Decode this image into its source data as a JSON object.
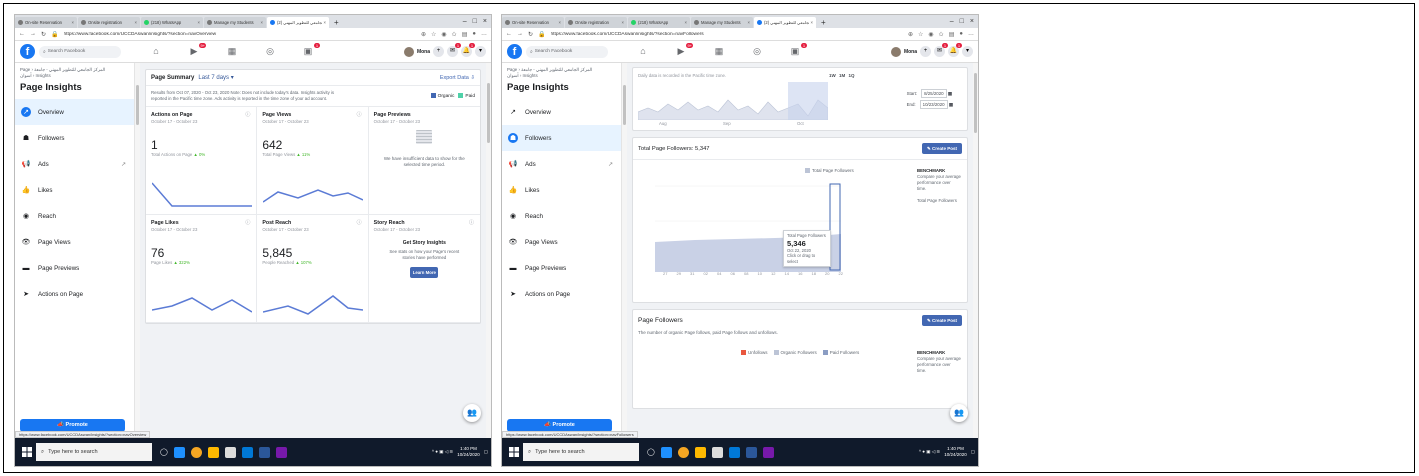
{
  "browser": {
    "tabs": [
      {
        "label": "On-site Reservation"
      },
      {
        "label": "Onsite registration"
      },
      {
        "label": "(218) WhatsApp"
      },
      {
        "label": "Manage my Students"
      },
      {
        "label": "المركز الجامعي للتطوير المهني (2)"
      }
    ]
  },
  "left": {
    "url": "https://www.facebook.com/UCCDAswan/insights/?section=navOverview",
    "status_url": "https://www.facebook.com/UCCDAswan/insights/?section=navOverview"
  },
  "right": {
    "url": "https://www.facebook.com/UCCDAswan/insights/?section=navFollowers",
    "status_url": "https://www.facebook.com/UCCDAswan/insights/?section=navFollowers"
  },
  "facebook": {
    "search_placeholder": "Search Facebook",
    "badges": {
      "watch": "9+",
      "notifications": "1",
      "messenger": "1",
      "alerts": "1"
    },
    "user_name": "Mona"
  },
  "sidebar": {
    "breadcrumb": "Page › المركز الجامعي للتطوير المهني - جامعة أسوان › Insights",
    "title": "Page Insights",
    "items": [
      {
        "label": "Overview",
        "icon": "overview-icon"
      },
      {
        "label": "Followers",
        "icon": "followers-icon"
      },
      {
        "label": "Ads",
        "icon": "ads-icon"
      },
      {
        "label": "Likes",
        "icon": "likes-icon"
      },
      {
        "label": "Reach",
        "icon": "reach-icon"
      },
      {
        "label": "Page Views",
        "icon": "page-views-icon"
      },
      {
        "label": "Page Previews",
        "icon": "page-previews-icon"
      },
      {
        "label": "Actions on Page",
        "icon": "actions-icon"
      }
    ],
    "promote": "Promote"
  },
  "overview": {
    "summary_title": "Page Summary",
    "summary_range": "Last 7 days",
    "export": "Export Data",
    "note": "Results from Oct 07, 2020 - Oct 23, 2020 Note: Does not include today's data. Insights activity is reported in the Pacific time zone. Ads activity is reported in the time zone of your ad account.",
    "legend_organic": "Organic",
    "legend_paid": "Paid",
    "colors": {
      "organic": "#4267b2",
      "paid": "#4fd1a8"
    },
    "cards": [
      {
        "title": "Actions on Page",
        "date": "October 17 - October 23",
        "value": "1",
        "stat": "Total Actions on Page",
        "change": "▲ 0%"
      },
      {
        "title": "Page Views",
        "date": "October 17 - October 23",
        "value": "642",
        "stat": "Total Page Views",
        "change": "▲ 11%"
      },
      {
        "title": "Page Previews",
        "date": "October 17 - October 23",
        "message": "We have insufficient data to show for the selected time period."
      },
      {
        "title": "Page Likes",
        "date": "October 17 - October 23",
        "value": "76",
        "stat": "Page Likes",
        "change": "▲ 322%"
      },
      {
        "title": "Post Reach",
        "date": "October 17 - October 23",
        "value": "5,845",
        "stat": "People Reached",
        "change": "▲ 107%"
      },
      {
        "title": "Story Reach",
        "date": "October 17 - October 23",
        "heading": "Get Story Insights",
        "message": "See stats on how your Page's recent stories have performed",
        "button": "Learn More"
      }
    ]
  },
  "followers": {
    "area_caption": "Daily data is recorded in the Pacific time zone.",
    "range_buttons": "1W 1M 1Q",
    "start_label": "Start:",
    "start_date": "8/25/2020",
    "end_label": "End:",
    "end_date": "10/23/2020",
    "months": [
      "Aug",
      "Sep",
      "Oct"
    ],
    "total_title": "Total Page Followers: 5,347",
    "create_post": "Create Post",
    "legend": "Total Page Followers",
    "bench_title": "BENCHMARK",
    "bench_desc": "Compare your average performance over time.",
    "bench_item": "Total Page Followers",
    "tooltip_title": "Total Page Followers",
    "tooltip_value": "5,346",
    "tooltip_date": "Oct 22, 2020",
    "tooltip_hint": "Click or drag to select",
    "x_ticks": [
      "27",
      "29",
      "31",
      "02",
      "04",
      "06",
      "08",
      "10",
      "12",
      "14",
      "16",
      "18",
      "20",
      "22"
    ],
    "page_followers_title": "Page Followers",
    "page_followers_sub": "The number of organic Page follows, paid Page follows and unfollows.",
    "legend_unfollows": "Unfollows",
    "legend_organic": "Organic Followers",
    "legend_paid": "Paid Followers"
  },
  "taskbar": {
    "search": "Type here to search",
    "time": "1:40 PM",
    "date": "10/24/2020"
  }
}
